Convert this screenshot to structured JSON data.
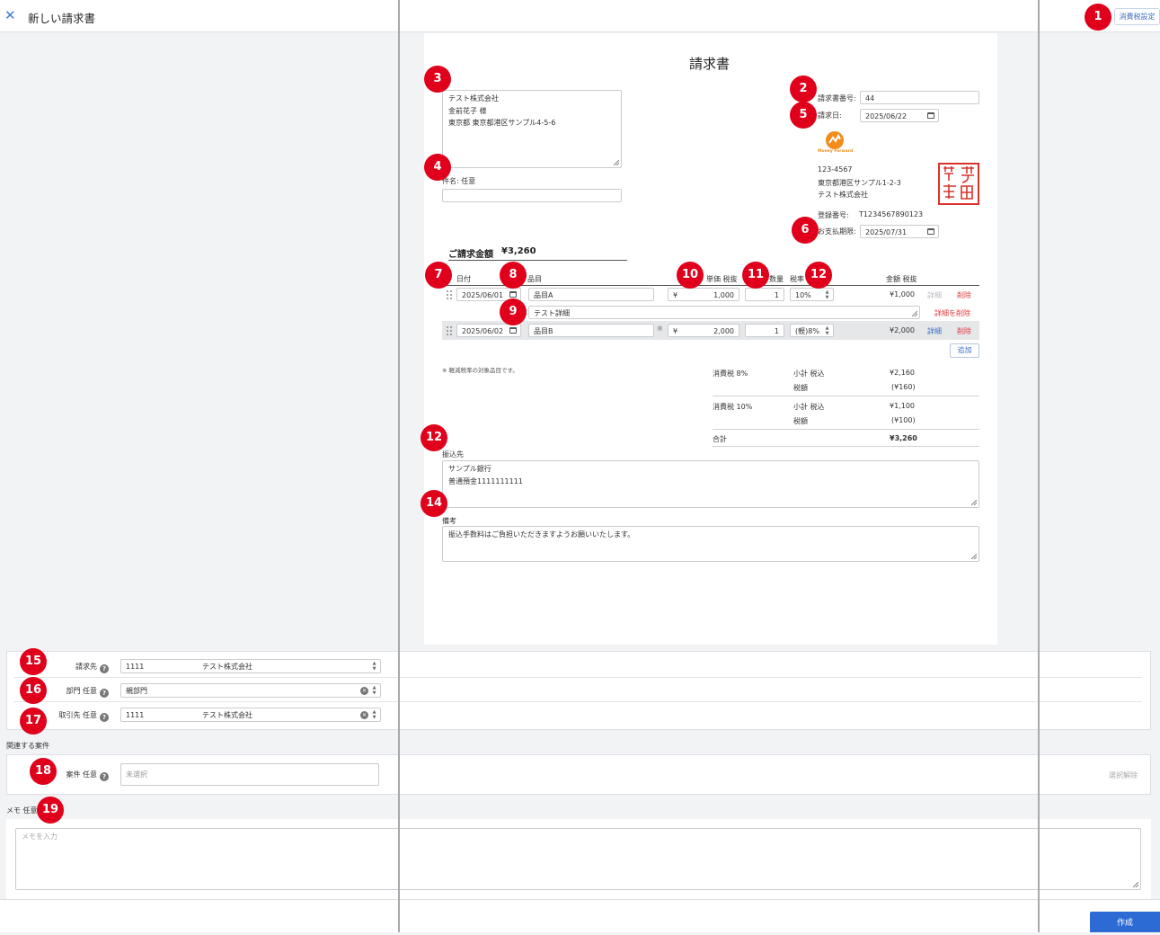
{
  "header": {
    "close_icon": "close-icon",
    "title": "新しい請求書",
    "tax_settings_label": "消費税設定"
  },
  "invoice": {
    "heading": "請求書",
    "recipient_lines": [
      "テスト株式会社",
      "金前花子 様",
      "東京都 東京都港区サンプル4-5-6"
    ],
    "subject_label": "件名: 任意",
    "subject_value": "",
    "invoice_number_label": "請求書番号:",
    "invoice_number": "44",
    "invoice_date_label": "請求日:",
    "invoice_date": "2025/06/22",
    "logo_text": "Money Forward",
    "sender_lines": [
      "123-4567",
      "東京都港区サンプル1-2-3",
      "テスト株式会社"
    ],
    "seal_text": "サンプル 株式会社",
    "registration_label": "登録番号:",
    "registration_number": "T1234567890123",
    "due_date_label": "お支払期限:",
    "due_date": "2025/07/31",
    "total_label": "ご請求金額",
    "total_amount": "¥3,260",
    "columns": {
      "date": "日付",
      "item": "品目",
      "unit_price": "単価 税抜",
      "quantity": "数量",
      "tax_rate": "税率",
      "amount": "金額 税抜"
    },
    "line_items": [
      {
        "date": "2025/06/01",
        "item": "品目A",
        "reduced_mark": "",
        "currency": "¥",
        "unit_price": "1,000",
        "quantity": "1",
        "tax_rate": "10%",
        "amount": "¥1,000",
        "detail_label": "詳細",
        "delete_label": "削除",
        "detail_text": "テスト詳細",
        "delete_detail_label": "詳細を削除"
      },
      {
        "date": "2025/06/02",
        "item": "品目B",
        "reduced_mark": "※",
        "currency": "¥",
        "unit_price": "2,000",
        "quantity": "1",
        "tax_rate": "(軽)8%",
        "amount": "¥2,000",
        "detail_label": "詳細",
        "delete_label": "削除"
      }
    ],
    "add_label": "追加",
    "reduced_note": "※ 軽減税率の対象品目です。",
    "tax_summary": [
      {
        "label": "消費税 8%",
        "subtotal_label": "小計 税込",
        "subtotal": "¥2,160",
        "tax_label": "税額",
        "tax": "(¥160)"
      },
      {
        "label": "消費税 10%",
        "subtotal_label": "小計 税込",
        "subtotal": "¥1,100",
        "tax_label": "税額",
        "tax": "(¥100)"
      }
    ],
    "grand_total_label": "合計",
    "grand_total": "¥3,260",
    "bank_label": "振込先",
    "bank_lines": [
      "サンプル銀行",
      "普通預金1111111111"
    ],
    "remarks_label": "備考",
    "remarks": "振込手数料はご負担いただきますようお願いいたします。"
  },
  "form": {
    "billing_label": "請求先",
    "billing_code": "1111",
    "billing_name": "テスト株式会社",
    "department_label": "部門 任意",
    "department_value": "親部門",
    "partner_label": "取引先 任意",
    "partner_code": "1111",
    "partner_name": "テスト株式会社",
    "related_section": "関連する案件",
    "project_label": "案件 任意",
    "project_placeholder": "未選択",
    "deselect_label": "選択解除",
    "memo_label": "メモ 任意",
    "memo_placeholder": "メモを入力",
    "create_label": "作成"
  },
  "badges": [
    "1",
    "2",
    "3",
    "4",
    "5",
    "6",
    "7",
    "8",
    "9",
    "10",
    "11",
    "12",
    "12",
    "14",
    "15",
    "16",
    "17",
    "18",
    "19"
  ],
  "colors": {
    "accent": "#2c6bd4",
    "badge": "#e0001b",
    "delete": "#e0393e",
    "seal": "#d9332e"
  }
}
